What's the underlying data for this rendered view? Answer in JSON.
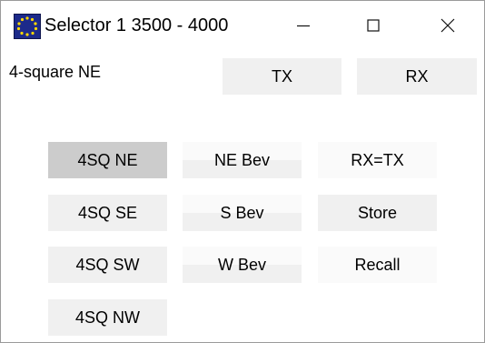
{
  "window": {
    "title": "Selector 1 3500 - 4000",
    "app_icon": "stars-flag-icon",
    "controls": [
      "minimize-icon",
      "maximize-icon",
      "close-icon"
    ]
  },
  "status": {
    "label": "4-square NE"
  },
  "top_buttons": {
    "tx": "TX",
    "rx": "RX"
  },
  "grid": {
    "col1": [
      "4SQ NE",
      "4SQ SE",
      "4SQ SW",
      "4SQ NW"
    ],
    "col2": [
      "NE Bev",
      "S Bev",
      "W Bev"
    ],
    "col3": [
      "RX=TX",
      "Store",
      "Recall"
    ]
  },
  "selected": "4SQ NE",
  "colors": {
    "selected_button": "#cccccc",
    "button": "#f0f0f0",
    "app_icon_bg": "#1c2a8a",
    "app_icon_stars": "#ffd800"
  }
}
